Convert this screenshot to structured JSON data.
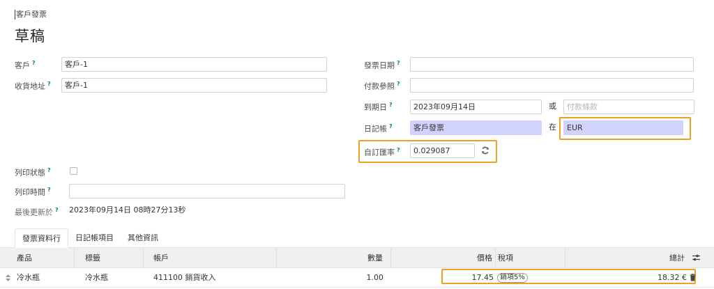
{
  "breadcrumb": "客戶發票",
  "title": "草稿",
  "left_fields": {
    "customer_label": "客戶",
    "customer_value": "客戶-1",
    "shipping_label": "收貨地址",
    "shipping_value": "客戶-1",
    "print_status_label": "列印狀態",
    "print_time_label": "列印時間",
    "print_time_value": "",
    "last_updated_label": "最後更新於",
    "last_updated_value": "2023年09月14日 08時27分13秒"
  },
  "right_fields": {
    "invoice_date_label": "發票日期",
    "invoice_date_value": "",
    "payment_ref_label": "付款參照",
    "payment_ref_value": "",
    "due_date_label": "到期日",
    "due_date_value": "2023年09月14日",
    "or_text": "或",
    "payment_terms_placeholder": "付款條款",
    "journal_label": "日記帳",
    "journal_value": "客戶發票",
    "in_text": "在",
    "currency_value": "EUR",
    "custom_rate_label": "自訂匯率",
    "custom_rate_value": "0.029087"
  },
  "help_mark": "?",
  "tabs": [
    "發票資料行",
    "日記帳項目",
    "其他資訊"
  ],
  "table": {
    "headers": {
      "product": "產品",
      "label": "標籤",
      "account": "帳戶",
      "quantity": "數量",
      "price": "價格",
      "taxes": "稅項",
      "total": "總計"
    },
    "rows": [
      {
        "product": "冷水瓶",
        "label": "冷水瓶",
        "account": "411100 銷貨收入",
        "quantity": "1.00",
        "price": "17.45",
        "tax_badge": "銷項5%",
        "total": "18.32 €"
      }
    ]
  },
  "icons": {
    "refresh": "refresh-icon",
    "columns": "optional-columns-icon",
    "trash": "trash-icon",
    "handle": "drag-handle-icon"
  },
  "colors": {
    "highlight": "#f0a020",
    "required_bg": "#d2d2ff",
    "help_mark": "#017e84"
  }
}
